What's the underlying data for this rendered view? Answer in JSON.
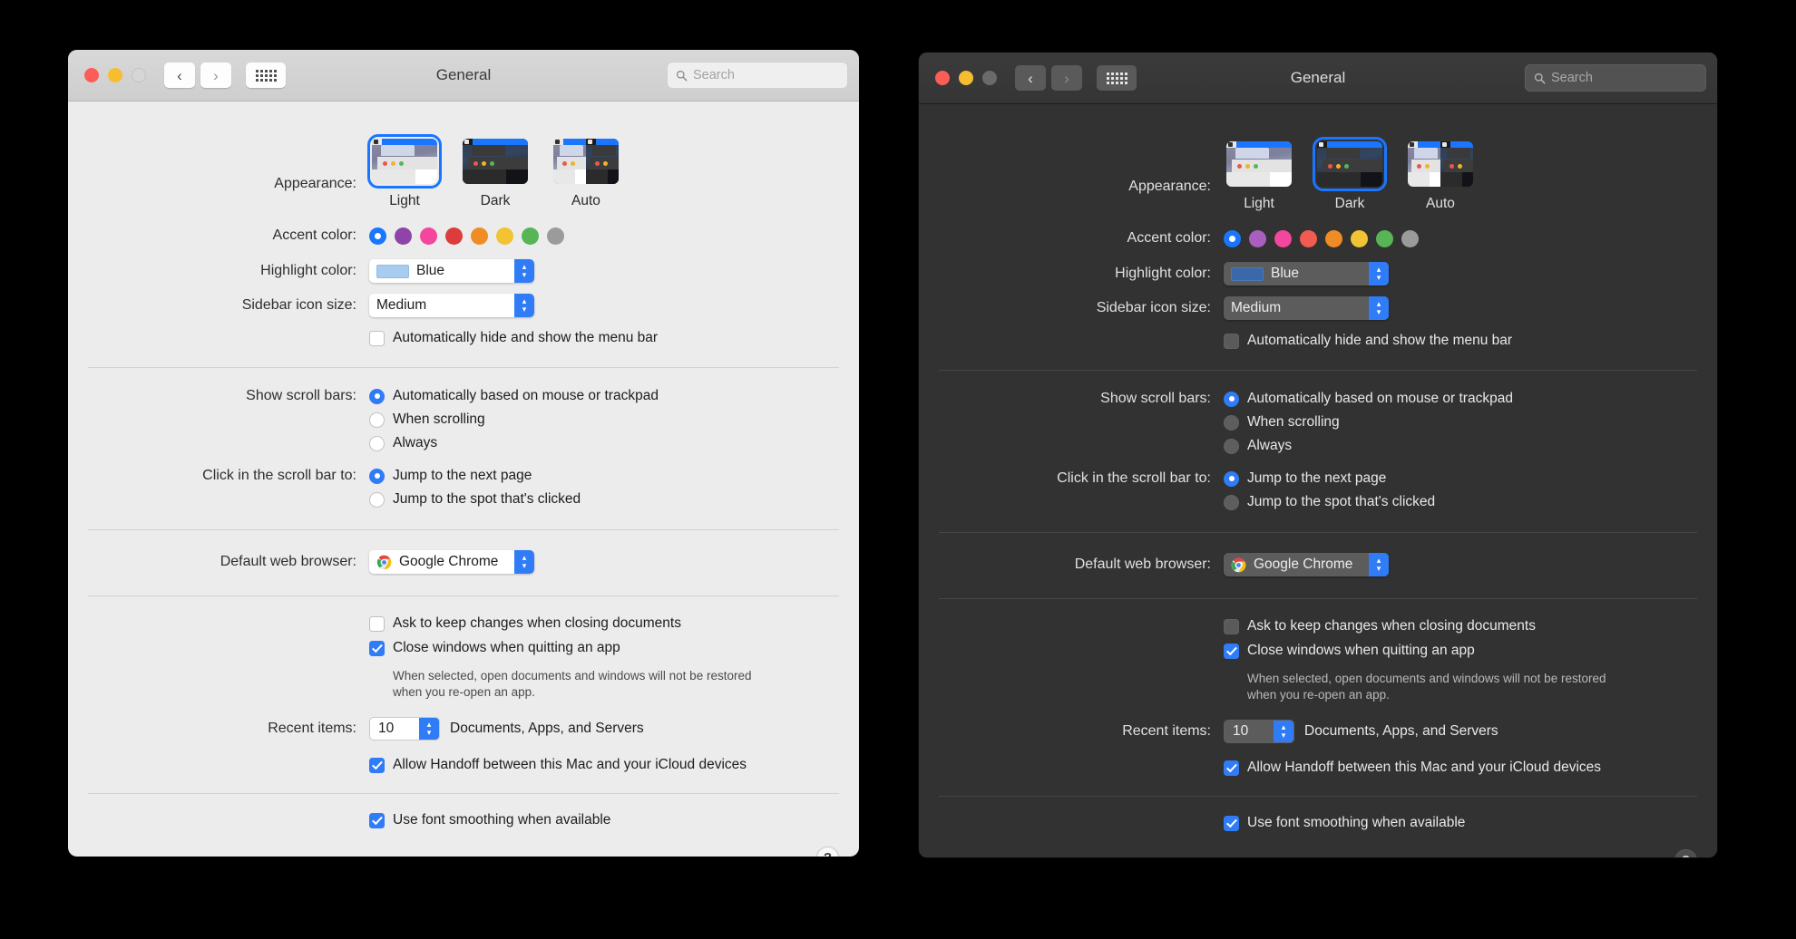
{
  "windows": [
    {
      "theme": "light",
      "titlebar": {
        "title": "General",
        "back_icon": "chevron-left-icon",
        "forward_icon": "chevron-right-icon",
        "grid_icon": "show-all-grid-icon",
        "search_placeholder": "Search",
        "search_icon": "search-icon"
      },
      "appearance": {
        "label": "Appearance:",
        "options": [
          {
            "label": "Light",
            "selected": true
          },
          {
            "label": "Dark",
            "selected": false
          },
          {
            "label": "Auto",
            "selected": false
          }
        ]
      },
      "accent_color": {
        "label": "Accent color:",
        "swatches": [
          {
            "name": "blue",
            "hex": "#1a76ff",
            "selected": true
          },
          {
            "name": "purple",
            "hex": "#8e44a8",
            "selected": false
          },
          {
            "name": "pink",
            "hex": "#f2479c",
            "selected": false
          },
          {
            "name": "red",
            "hex": "#dc3c3c",
            "selected": false
          },
          {
            "name": "orange",
            "hex": "#ef8c24",
            "selected": false
          },
          {
            "name": "yellow",
            "hex": "#f2c333",
            "selected": false
          },
          {
            "name": "green",
            "hex": "#58b555",
            "selected": false
          },
          {
            "name": "gray",
            "hex": "#9b9b9b",
            "selected": false
          }
        ]
      },
      "highlight_color": {
        "label": "Highlight color:",
        "value": "Blue"
      },
      "sidebar_icon_size": {
        "label": "Sidebar icon size:",
        "value": "Medium"
      },
      "menu_bar_autohide": {
        "label": "Automatically hide and show the menu bar",
        "checked": false
      },
      "scroll_bars": {
        "label": "Show scroll bars:",
        "options": [
          {
            "label": "Automatically based on mouse or trackpad",
            "selected": true
          },
          {
            "label": "When scrolling",
            "selected": false
          },
          {
            "label": "Always",
            "selected": false
          }
        ]
      },
      "scroll_click": {
        "label": "Click in the scroll bar to:",
        "options": [
          {
            "label": "Jump to the next page",
            "selected": true
          },
          {
            "label": "Jump to the spot that's clicked",
            "selected": false
          }
        ]
      },
      "default_browser": {
        "label": "Default web browser:",
        "value": "Google Chrome",
        "icon": "chrome-icon"
      },
      "ask_keep_changes": {
        "label": "Ask to keep changes when closing documents",
        "checked": false
      },
      "close_windows": {
        "label": "Close windows when quitting an app",
        "checked": true
      },
      "close_windows_hint": "When selected, open documents and windows will not be restored when you re-open an app.",
      "recent_items": {
        "label": "Recent items:",
        "value": "10",
        "suffix": "Documents, Apps, and Servers"
      },
      "handoff": {
        "label": "Allow Handoff between this Mac and your iCloud devices",
        "checked": true
      },
      "font_smoothing": {
        "label": "Use font smoothing when available",
        "checked": true
      },
      "help_button": {
        "label": "?",
        "icon": "help-icon"
      }
    },
    {
      "theme": "dark",
      "titlebar": {
        "title": "General",
        "back_icon": "chevron-left-icon",
        "forward_icon": "chevron-right-icon",
        "grid_icon": "show-all-grid-icon",
        "search_placeholder": "Search",
        "search_icon": "search-icon"
      },
      "appearance": {
        "label": "Appearance:",
        "options": [
          {
            "label": "Light",
            "selected": false
          },
          {
            "label": "Dark",
            "selected": true
          },
          {
            "label": "Auto",
            "selected": false
          }
        ]
      },
      "accent_color": {
        "label": "Accent color:",
        "swatches": [
          {
            "name": "blue",
            "hex": "#1a76ff",
            "selected": true
          },
          {
            "name": "purple",
            "hex": "#a95fc0",
            "selected": false
          },
          {
            "name": "pink",
            "hex": "#f2479c",
            "selected": false
          },
          {
            "name": "red",
            "hex": "#f25c50",
            "selected": false
          },
          {
            "name": "orange",
            "hex": "#ef8c24",
            "selected": false
          },
          {
            "name": "yellow",
            "hex": "#f2c333",
            "selected": false
          },
          {
            "name": "green",
            "hex": "#58b555",
            "selected": false
          },
          {
            "name": "gray",
            "hex": "#9b9b9b",
            "selected": false
          }
        ]
      },
      "highlight_color": {
        "label": "Highlight color:",
        "value": "Blue"
      },
      "sidebar_icon_size": {
        "label": "Sidebar icon size:",
        "value": "Medium"
      },
      "menu_bar_autohide": {
        "label": "Automatically hide and show the menu bar",
        "checked": false
      },
      "scroll_bars": {
        "label": "Show scroll bars:",
        "options": [
          {
            "label": "Automatically based on mouse or trackpad",
            "selected": true
          },
          {
            "label": "When scrolling",
            "selected": false
          },
          {
            "label": "Always",
            "selected": false
          }
        ]
      },
      "scroll_click": {
        "label": "Click in the scroll bar to:",
        "options": [
          {
            "label": "Jump to the next page",
            "selected": true
          },
          {
            "label": "Jump to the spot that's clicked",
            "selected": false
          }
        ]
      },
      "default_browser": {
        "label": "Default web browser:",
        "value": "Google Chrome",
        "icon": "chrome-icon"
      },
      "ask_keep_changes": {
        "label": "Ask to keep changes when closing documents",
        "checked": false
      },
      "close_windows": {
        "label": "Close windows when quitting an app",
        "checked": true
      },
      "close_windows_hint": "When selected, open documents and windows will not be restored when you re-open an app.",
      "recent_items": {
        "label": "Recent items:",
        "value": "10",
        "suffix": "Documents, Apps, and Servers"
      },
      "handoff": {
        "label": "Allow Handoff between this Mac and your iCloud devices",
        "checked": true
      },
      "font_smoothing": {
        "label": "Use font smoothing when available",
        "checked": true
      },
      "help_button": {
        "label": "?",
        "icon": "help-icon"
      }
    }
  ]
}
